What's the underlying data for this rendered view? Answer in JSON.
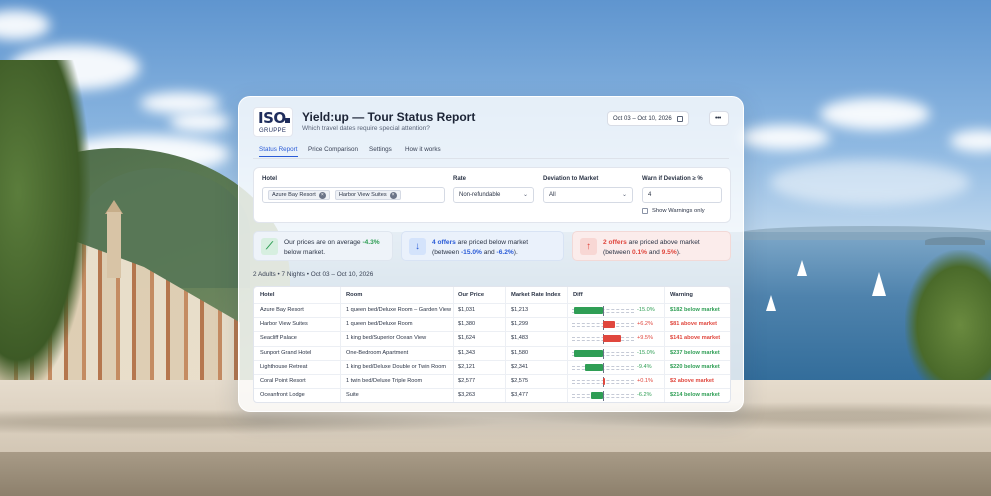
{
  "brand": {
    "logo_text": "ISO",
    "logo_sub": "GRUPPE"
  },
  "header": {
    "title": "Yield:up — Tour Status Report",
    "subtitle": "Which travel dates require special attention?",
    "date_range": "Oct 03 – Oct 10, 2026",
    "more_label": "•••"
  },
  "tabs": [
    "Status Report",
    "Price Comparison",
    "Settings",
    "How it works"
  ],
  "filters": {
    "hotel_label": "Hotel",
    "hotel_chips": [
      "Azure Bay Resort",
      "Harbor View Suites"
    ],
    "rate_label": "Rate",
    "rate_value": "Non-refundable",
    "deviation_label": "Deviation to Market",
    "deviation_value": "All",
    "warn_label": "Warn if Deviation ≥ %",
    "warn_value": "4",
    "show_warnings_label": "Show Warnings only"
  },
  "summary": {
    "card1": {
      "line1_pre": "Our prices are on average ",
      "value": "-4.3%",
      "line2": "below market."
    },
    "card2": {
      "count": "4 offers",
      "text": " are priced below market",
      "line2_pre": "(between ",
      "a": "-15.0%",
      "mid": " and ",
      "b": "-6.2%",
      "end": ")."
    },
    "card3": {
      "count": "2 offers",
      "text": " are priced above market",
      "line2_pre": "(between ",
      "a": "0.1%",
      "mid": " and ",
      "b": "9.5%",
      "end": ")."
    }
  },
  "meta": "2 Adults • 7 Nights • Oct 03 – Oct 10, 2026",
  "table": {
    "headers": [
      "Hotel",
      "Room",
      "Our Price",
      "Market Rate Index",
      "Diff",
      "Warning"
    ],
    "rows": [
      {
        "hotel": "Azure Bay Resort",
        "room": "1 queen bed/Deluxe Room – Garden View",
        "price": "$1,031",
        "market": "$1,213",
        "diff": "-15.0%",
        "diff_value": -15.0,
        "warning": "$182 below market",
        "dir": "below"
      },
      {
        "hotel": "Harbor View Suites",
        "room": "1 queen bed/Deluxe Room",
        "price": "$1,380",
        "market": "$1,299",
        "diff": "+6.2%",
        "diff_value": 6.2,
        "warning": "$81 above market",
        "dir": "above"
      },
      {
        "hotel": "Seacliff Palace",
        "room": "1 king bed/Superior Ocean View",
        "price": "$1,624",
        "market": "$1,483",
        "diff": "+9.5%",
        "diff_value": 9.5,
        "warning": "$141 above market",
        "dir": "above"
      },
      {
        "hotel": "Sunport Grand Hotel",
        "room": "One-Bedroom Apartment",
        "price": "$1,343",
        "market": "$1,580",
        "diff": "-15.0%",
        "diff_value": -15.0,
        "warning": "$237 below market",
        "dir": "below"
      },
      {
        "hotel": "Lighthouse Retreat",
        "room": "1 king bed/Deluxe Double or Twin Room",
        "price": "$2,121",
        "market": "$2,341",
        "diff": "-9.4%",
        "diff_value": -9.4,
        "warning": "$220 below market",
        "dir": "below"
      },
      {
        "hotel": "Coral Point Resort",
        "room": "1 twin bed/Deluxe Triple Room",
        "price": "$2,577",
        "market": "$2,575",
        "diff": "+0.1%",
        "diff_value": 0.1,
        "warning": "$2 above market",
        "dir": "above"
      },
      {
        "hotel": "Oceanfront Lodge",
        "room": "Suite",
        "price": "$3,263",
        "market": "$3,477",
        "diff": "-6.2%",
        "diff_value": -6.2,
        "warning": "$214 below market",
        "dir": "below"
      }
    ]
  },
  "colors": {
    "accent": "#2a5bd7",
    "below": "#2f9e55",
    "above": "#e0473e"
  },
  "icons": {
    "card1": "trend-chart-icon",
    "card2": "arrow-down-icon",
    "card3": "arrow-up-icon"
  }
}
